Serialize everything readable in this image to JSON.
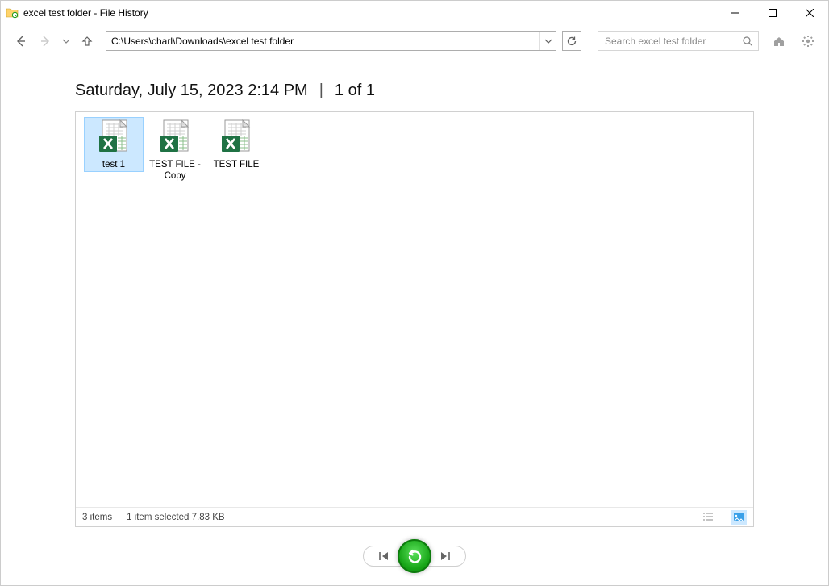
{
  "titlebar": {
    "title": "excel test folder - File History"
  },
  "toolbar": {
    "path": "C:\\Users\\charl\\Downloads\\excel test folder",
    "search_placeholder": "Search excel test folder"
  },
  "header": {
    "timestamp": "Saturday, July 15, 2023 2:14 PM",
    "position": "1 of 1"
  },
  "files": [
    {
      "name": "test 1",
      "selected": true
    },
    {
      "name": "TEST FILE - Copy",
      "selected": false
    },
    {
      "name": "TEST FILE",
      "selected": false
    }
  ],
  "status": {
    "count": "3 items",
    "selection": "1 item selected  7.83 KB"
  }
}
